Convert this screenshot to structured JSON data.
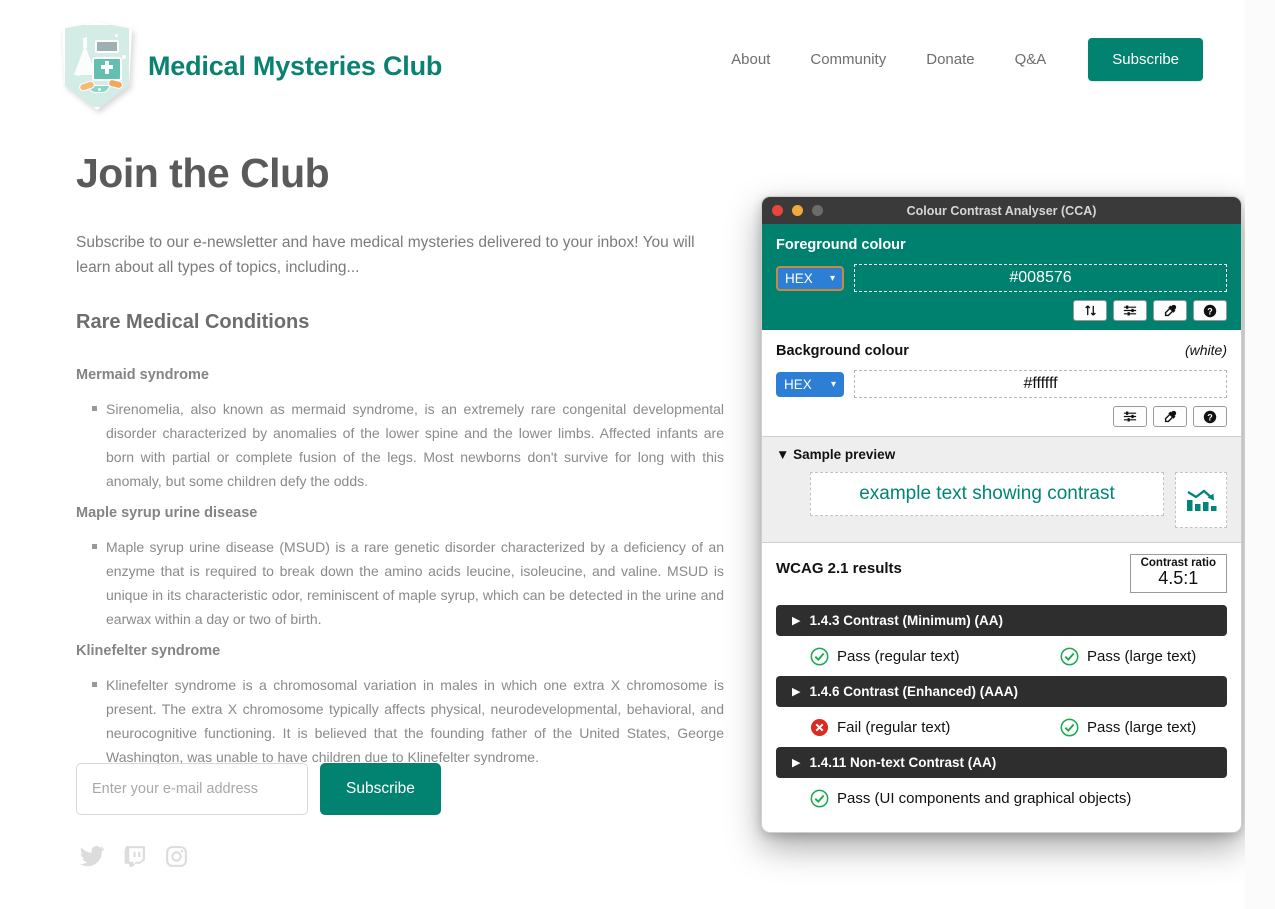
{
  "site": {
    "brand_title": "Medical Mysteries Club",
    "logo_icon": "medical-shield-badge-icon",
    "nav": [
      {
        "label": "About"
      },
      {
        "label": "Community"
      },
      {
        "label": "Donate"
      },
      {
        "label": "Q&A"
      }
    ],
    "nav_button_label": "Subscribe"
  },
  "article": {
    "page_title": "Join the Club",
    "intro": "Subscribe to our e-newsletter and have medical mysteries delivered to your inbox! You will learn about all types of topics, including...",
    "section_heading": "Rare Medical Conditions",
    "conditions": [
      {
        "title": "Mermaid syndrome",
        "body": "Sirenomelia, also known as mermaid syndrome, is an extremely rare congenital developmental disorder characterized by anomalies of the lower spine and the lower limbs. Affected infants are born with partial or complete fusion of the legs. Most newborns don't survive for long with this anomaly, but some children defy the odds."
      },
      {
        "title": "Maple syrup urine disease",
        "body": "Maple syrup urine disease (MSUD) is a rare genetic disorder characterized by a deficiency of an enzyme that is required to break down the amino acids leucine, isoleucine, and valine. MSUD is unique in its characteristic odor, reminiscent of maple syrup, which can be detected in the urine and earwax within a day or two of birth."
      },
      {
        "title": "Klinefelter syndrome",
        "body": "Klinefelter syndrome is a chromosomal variation in males in which one extra X chromosome is present. The extra X chromosome typically affects physical, neurodevelopmental, behavioral, and neurocognitive functioning. It is believed that the founding father of the United States, George Washington, was unable to have children due to Klinefelter syndrome."
      }
    ]
  },
  "signup": {
    "email_placeholder": "Enter your e-mail address",
    "email_value": "",
    "submit_label": "Subscribe"
  },
  "social": [
    {
      "icon": "twitter-icon",
      "name": "Twitter"
    },
    {
      "icon": "twitch-icon",
      "name": "Twitch"
    },
    {
      "icon": "instagram-icon",
      "name": "Instagram"
    }
  ],
  "cca": {
    "window_title": "Colour Contrast Analyser (CCA)",
    "traffic_lights": [
      "close",
      "minimise",
      "zoom"
    ],
    "foreground": {
      "label": "Foreground colour",
      "format": "HEX",
      "value": "#008576",
      "tools": [
        "swap-colours-icon",
        "sliders-icon",
        "eyedropper-icon",
        "help-icon"
      ]
    },
    "background": {
      "label": "Background colour",
      "colour_name": "(white)",
      "format": "HEX",
      "value": "#ffffff",
      "tools": [
        "sliders-icon",
        "eyedropper-icon",
        "help-icon"
      ]
    },
    "preview": {
      "disclosure_label": "Sample preview",
      "expanded": true,
      "sample_text": "example text showing contrast",
      "sample_graphic": "bar-chart-declining-icon"
    },
    "results": {
      "title": "WCAG 2.1 results",
      "contrast_ratio_label": "Contrast ratio",
      "contrast_ratio_value": "4.5:1",
      "criteria": [
        {
          "label": "1.4.3 Contrast (Minimum) (AA)",
          "results": [
            {
              "status": "pass",
              "text": "Pass (regular text)"
            },
            {
              "status": "pass",
              "text": "Pass (large text)"
            }
          ]
        },
        {
          "label": "1.4.6 Contrast (Enhanced) (AAA)",
          "results": [
            {
              "status": "fail",
              "text": "Fail (regular text)"
            },
            {
              "status": "pass",
              "text": "Pass (large text)"
            }
          ]
        },
        {
          "label": "1.4.11 Non-text Contrast (AA)",
          "results": [
            {
              "status": "pass",
              "text": "Pass (UI components and graphical objects)"
            }
          ]
        }
      ]
    }
  },
  "colors": {
    "brand_teal": "#0a8271",
    "button_teal": "#028270",
    "cca_panel_teal": "#00806f",
    "sample_text": "#008576",
    "pass_green": "#1ba84f",
    "fail_red": "#d92b20",
    "titlebar": "#3a3a3a",
    "criterion_bar": "#2e2e2e",
    "select_blue": "#2c7fd4"
  }
}
